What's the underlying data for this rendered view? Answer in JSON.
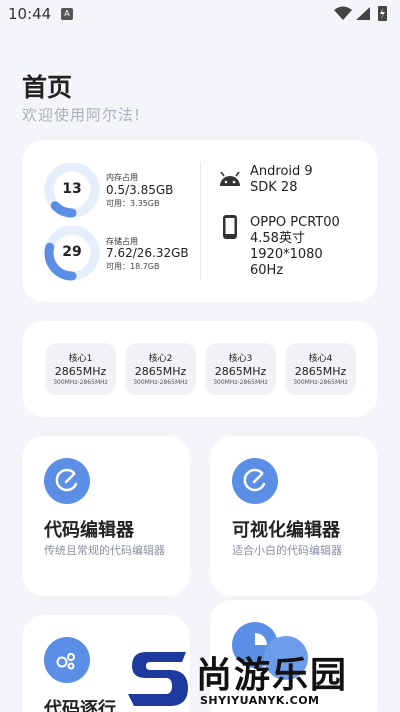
{
  "status_bar": {
    "time": "10:44",
    "notification_badge": "A",
    "icons": [
      "wifi-icon",
      "signal-icon",
      "battery-charging-icon"
    ]
  },
  "header": {
    "title": "首页",
    "subtitle": "欢迎使用阿尔法!"
  },
  "memory": {
    "ram": {
      "percent": 13,
      "label": "内存占用",
      "value": "0.5/3.85GB",
      "free": "可用：3.35GB"
    },
    "storage": {
      "percent": 29,
      "label": "存储占用",
      "value": "7.62/26.32GB",
      "free": "可用：18.7GB"
    }
  },
  "device": {
    "os": "Android 9",
    "sdk": "SDK 28",
    "model": "OPPO PCRT00",
    "screen_size": "4.58英寸",
    "resolution": "1920*1080",
    "refresh_rate": "60Hz"
  },
  "cores": [
    {
      "name": "核心1",
      "freq": "2865MHz",
      "range": "300MHz-2865MHz"
    },
    {
      "name": "核心2",
      "freq": "2865MHz",
      "range": "300MHz-2865MHz"
    },
    {
      "name": "核心3",
      "freq": "2865MHz",
      "range": "300MHz-2865MHz"
    },
    {
      "name": "核心4",
      "freq": "2865MHz",
      "range": "300MHz-2865MHz"
    }
  ],
  "tools": [
    {
      "title": "代码编辑器",
      "desc": "传统且常规的代码编辑器",
      "icon": "edit-icon"
    },
    {
      "title": "可视化编辑器",
      "desc": "适合小白的代码编辑器",
      "icon": "edit-icon"
    },
    {
      "title": "代码逐行",
      "desc": "",
      "icon": "bubbles-icon"
    },
    {
      "title": "",
      "desc": "",
      "icon": "chart-icon"
    }
  ],
  "watermark": {
    "text": "尚游乐园",
    "url": "SHYIYUANYK.COM"
  },
  "colors": {
    "accent": "#5b8fe6",
    "ring_track": "#e6edfb",
    "background": "#f4f5f8",
    "card": "#ffffff"
  }
}
